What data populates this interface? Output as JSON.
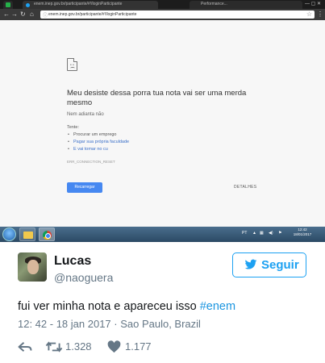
{
  "browser": {
    "tabs": [
      {
        "title": ""
      },
      {
        "title": "",
        "url": "enem.inep.gov.br/participante/#!/loginParticipante"
      },
      {
        "title": "Performance..."
      }
    ],
    "window_controls": "— ▢ ✕",
    "address": "enem.inep.gov.br/participante/#!/loginParticipante",
    "error_page": {
      "title": "Meu desiste dessa porra tua nota vai ser uma merda mesmo",
      "subtitle": "Nem adianta não",
      "try_label": "Tente:",
      "suggestions": [
        "Procurar um emprego",
        "Pagar sua própria faculdade",
        "E vai tomar no cu"
      ],
      "error_code": "ERR_CONNECTION_RESET",
      "reload_label": "Recarregar",
      "details_label": "DETALHES"
    },
    "taskbar": {
      "tray_text": "PT",
      "clock_time": "12:42",
      "clock_date": "18/01/2017"
    }
  },
  "tweet": {
    "display_name": "Lucas",
    "handle": "@naoguera",
    "follow_label": "Seguir",
    "text": "fui ver minha nota e apareceu isso ",
    "hashtag": "#enem",
    "meta": "12: 42 - 18 jan 2017 · Sao Paulo, Brazil",
    "retweets": "1.328",
    "likes": "1.177",
    "accent_color": "#1da1f2"
  }
}
